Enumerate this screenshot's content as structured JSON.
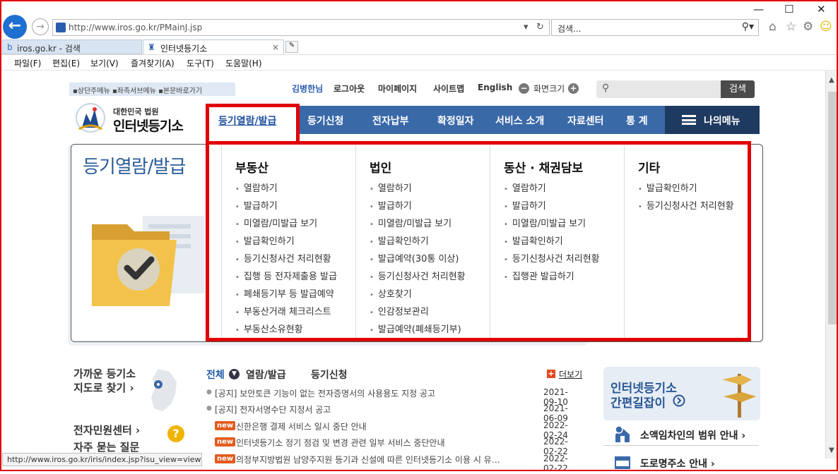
{
  "browser": {
    "url": "http://www.iros.go.kr/PMainJ.jsp",
    "search_placeholder": "검색...",
    "tabs": [
      {
        "label": "iros.go.kr - 검색"
      },
      {
        "label": "인터넷등기소"
      }
    ],
    "menu": [
      "파일(F)",
      "편집(E)",
      "보기(V)",
      "즐겨찾기(A)",
      "도구(T)",
      "도움말(H)"
    ],
    "status_url": "http://www.iros.go.kr/iris/index.jsp?isu_view=view"
  },
  "header": {
    "skip_links": "▪상단주메뉴 ▪좌측서브메뉴 ▪본문바로가기",
    "user": "김병한님",
    "logout": "로그아웃",
    "mypage": "마이페이지",
    "sitemap": "사이트맵",
    "english": "English",
    "font_size": "화면크기",
    "search_button": "검색",
    "logo_small": "대한민국 법원",
    "logo_large": "인터넷등기소"
  },
  "gnb": {
    "items": [
      "등기열람/발급",
      "등기신청",
      "전자납부",
      "확정일자",
      "서비스 소개",
      "자료센터",
      "통 계"
    ],
    "my_menu": "나의메뉴"
  },
  "hero": {
    "title": "등기열람/발급"
  },
  "dropdown": {
    "columns": [
      {
        "title": "부동산",
        "items": [
          "열람하기",
          "발급하기",
          "미열람/미발급 보기",
          "발급확인하기",
          "등기신청사건 처리현황",
          "집행 등 전자제출용 발급",
          "폐쇄등기부 등 발급예약",
          "부동산거래 체크리스트",
          "부동산소유현황"
        ]
      },
      {
        "title": "법인",
        "items": [
          "열람하기",
          "발급하기",
          "미열람/미발급 보기",
          "발급확인하기",
          "발급예약(30통 이상)",
          "등기신청사건 처리현황",
          "상호찾기",
          "인감정보관리",
          "발급예약(폐쇄등기부)"
        ]
      },
      {
        "title": "동산 · 채권담보",
        "items": [
          "열람하기",
          "발급하기",
          "미열람/미발급 보기",
          "발급확인하기",
          "등기신청사건 처리현황",
          "집행관 발급하기"
        ]
      },
      {
        "title": "기타",
        "items": [
          "발급확인하기",
          "등기신청사건 처리현황"
        ]
      }
    ]
  },
  "left_links": {
    "near_office_1": "가까운 등기소",
    "near_office_2": "지도로 찾기 ›",
    "civil_center": "전자민원센터 ›",
    "faq": "자주 묻는 질문"
  },
  "notice": {
    "tabs": [
      "전체",
      "열람/발급",
      "등기신청"
    ],
    "more": "더보기",
    "items": [
      {
        "badge": "",
        "title": "[공지] 보안토큰 기능이 없는 전자증명서의 사용용도 지정 공고",
        "date": "2021-09-10"
      },
      {
        "badge": "",
        "title": "[공지] 전자서명수단 지정서 공고",
        "date": "2021-06-09"
      },
      {
        "badge": "new",
        "title": "신한은행 결제 서비스 일시 중단 안내",
        "date": "2022-02-24"
      },
      {
        "badge": "new",
        "title": "인터넷등기소 정기 점검 및 변경 관련 일부 서비스 중단안내",
        "date": "2022-02-22"
      },
      {
        "badge": "new",
        "title": "의정부지방법원 남양주지원 등기과 신설에 따른 인터넷등기소 이용 시 유…",
        "date": "2022-02-22"
      }
    ]
  },
  "side": {
    "card_line1": "인터넷등기소",
    "card_line2": "간편길잡이",
    "rows": [
      "소액임차인의 범위 안내 ›",
      "도로명주소 안내 ›"
    ]
  },
  "colors": {
    "gnb": "#3a69a8",
    "highlight": "#e00000",
    "new_badge": "#e35a1f"
  }
}
